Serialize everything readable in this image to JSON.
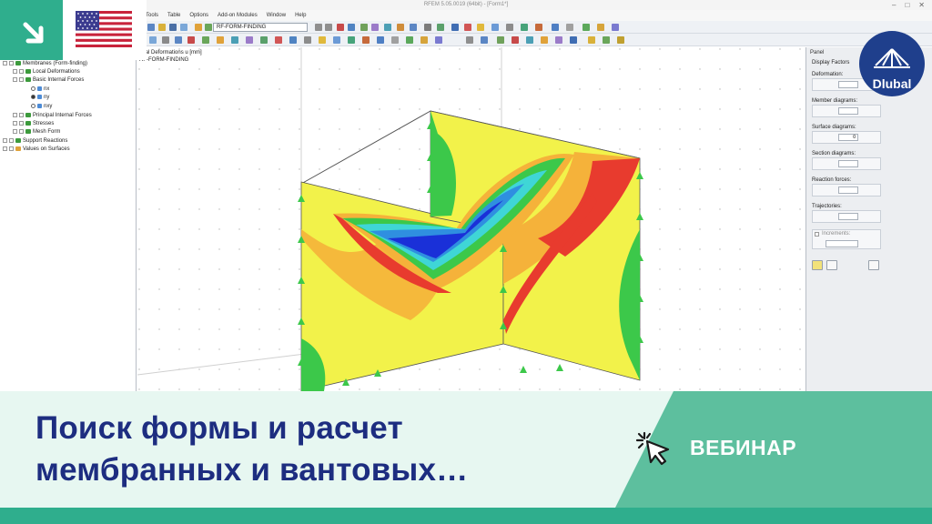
{
  "app": {
    "window_title": "RFEM 5.05.0019 (64bit) - [Form1*]",
    "window_controls": [
      "–",
      "□",
      "✕"
    ],
    "menu": [
      "Tools",
      "Table",
      "Options",
      "Add-on Modules",
      "Window",
      "Help"
    ],
    "module_combo_value": "RF-FORM-FINDING"
  },
  "navigator": {
    "items": [
      {
        "label": "Membranes (Form-finding)",
        "icon": "membrane-icon"
      },
      {
        "label": "Local Deformations",
        "icon": "deformation-icon"
      },
      {
        "label": "Basic Internal Forces",
        "icon": "forces-icon"
      },
      {
        "label": "nx",
        "icon": "radio-icon"
      },
      {
        "label": "ny",
        "icon": "radio-icon"
      },
      {
        "label": "nxy",
        "icon": "radio-icon"
      },
      {
        "label": "Principal Internal Forces",
        "icon": "forces-icon"
      },
      {
        "label": "Stresses",
        "icon": "stress-icon"
      },
      {
        "label": "Mesh Form",
        "icon": "mesh-icon"
      },
      {
        "label": "Support Reactions",
        "icon": "support-icon"
      },
      {
        "label": "Values on Surfaces",
        "icon": "surface-icon"
      }
    ]
  },
  "viewport": {
    "label_line1": "obal Deformations u [mm]",
    "label_line2": "RF-FORM-FINDING"
  },
  "panel": {
    "title": "Panel",
    "section": "Display Factors",
    "deformation_label": "Deformation:",
    "member_diagrams_label": "Member diagrams:",
    "surface_diagrams_label": "Surface diagrams:",
    "surface_diagrams_value": "0",
    "section_diagrams_label": "Section diagrams:",
    "reaction_forces_label": "Reaction forces:",
    "trajectories_label": "Trajectories:",
    "increments_label": "Increments:"
  },
  "overlay": {
    "logo_text": "Dlubal",
    "title_line1": "Поиск формы и расчет",
    "title_line2": "мембранных и вантовых…",
    "webinar_label": "ВЕБИНАР"
  },
  "colors": {
    "brand_green": "#2fae8d",
    "banner_bg": "#e7f7f1",
    "title_blue": "#1d2d80",
    "logo_blue": "#1f3f8c"
  }
}
